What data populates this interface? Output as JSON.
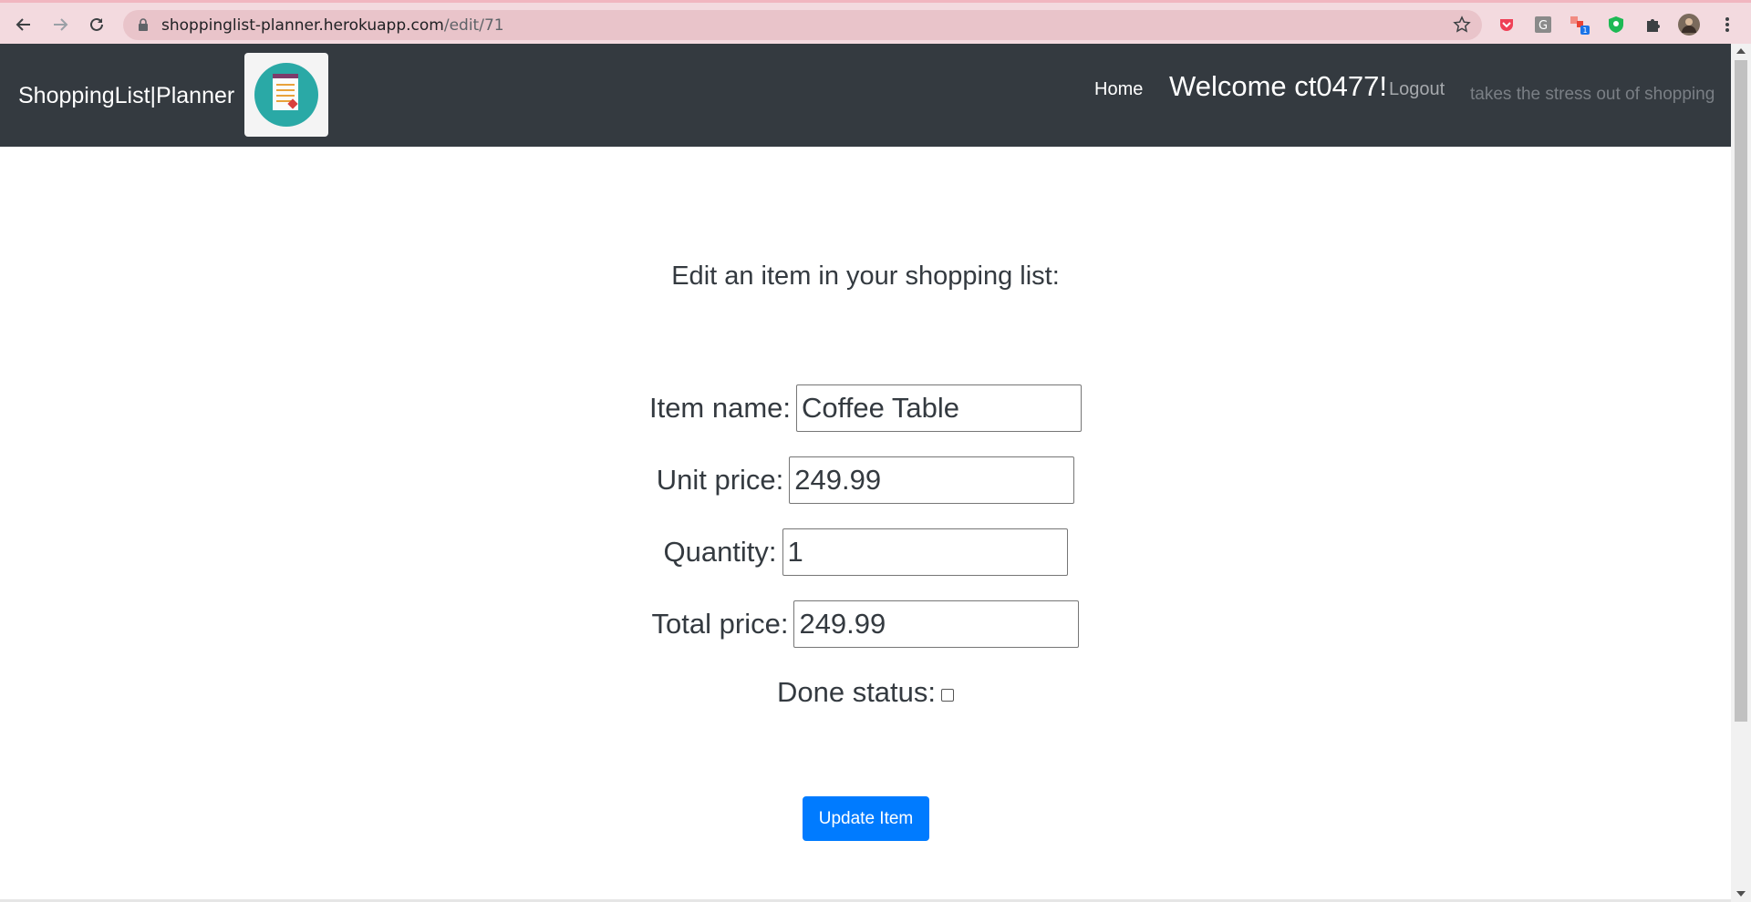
{
  "browser": {
    "url_host": "shoppinglist-planner.herokuapp.com",
    "url_path": "/edit/71",
    "extension_badge": "1"
  },
  "navbar": {
    "brand": "ShoppingList|Planner",
    "home": "Home",
    "welcome": "Welcome ct0477!",
    "logout": "Logout",
    "tagline": "takes the stress out of shopping"
  },
  "form": {
    "heading": "Edit an item in your shopping list:",
    "item_name_label": "Item name:",
    "item_name_value": "Coffee Table",
    "unit_price_label": "Unit price:",
    "unit_price_value": "249.99",
    "quantity_label": "Quantity:",
    "quantity_value": "1",
    "total_price_label": "Total price:",
    "total_price_value": "249.99",
    "done_status_label": "Done status:",
    "done_checked": false,
    "submit_label": "Update Item"
  },
  "colors": {
    "navbar_bg": "#343a40",
    "button_primary": "#007bff",
    "chrome_bg": "#f3dadf"
  }
}
